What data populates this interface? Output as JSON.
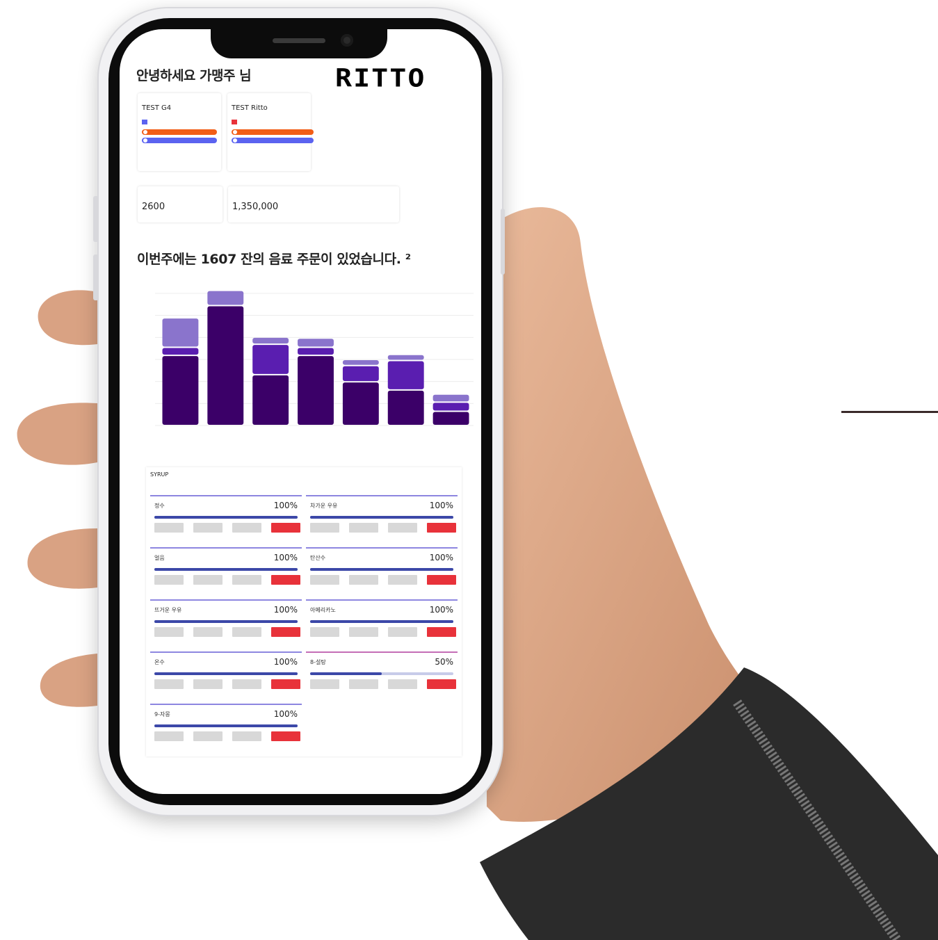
{
  "header": {
    "greeting": "안녕하세요  가맹주 님",
    "logo": "RITTO"
  },
  "machines": [
    {
      "caption": "",
      "name": "TEST G4",
      "status": "",
      "alert": "",
      "ok": "",
      "link": ""
    },
    {
      "caption": "",
      "name": "TEST Ritto",
      "status": "",
      "alert": "",
      "ok": "",
      "link": ""
    }
  ],
  "kpis": [
    {
      "caption": "",
      "value": "2600",
      "delta": ""
    },
    {
      "caption": "",
      "value": "1,350,000",
      "delta": ""
    }
  ],
  "weekly": {
    "headline": "이번주에는 1607 잔의 음료 주문이 있었습니다. ²",
    "subline": "",
    "footnotes": [
      "",
      ""
    ]
  },
  "chart_data": {
    "type": "bar",
    "stacked": true,
    "categories": [
      "",
      "",
      "",
      "",
      "",
      "",
      ""
    ],
    "series": [
      {
        "values": [
          345,
          590,
          250,
          345,
          215,
          175,
          70
        ],
        "color": "#3b0068"
      },
      {
        "values": [
          40,
          0,
          150,
          40,
          80,
          145,
          45
        ],
        "color": "#5a1eb0"
      },
      {
        "values": [
          145,
          75,
          35,
          45,
          30,
          30,
          40
        ],
        "color": "#8a74cc"
      }
    ],
    "ylim": [
      0,
      650
    ],
    "grid": true,
    "legend": "none"
  },
  "syrup": {
    "title": "SYRUP",
    "subtitle": "",
    "items": [
      {
        "name": "정수",
        "percent": "100%",
        "level": 1.0,
        "buttons": [
          "",
          "",
          "",
          ""
        ]
      },
      {
        "name": "차가운 우유",
        "percent": "100%",
        "level": 1.0,
        "buttons": [
          "",
          "",
          "",
          ""
        ]
      },
      {
        "name": "얼음",
        "percent": "100%",
        "level": 1.0,
        "buttons": [
          "",
          "",
          "",
          ""
        ]
      },
      {
        "name": "탄산수",
        "percent": "100%",
        "level": 1.0,
        "buttons": [
          "",
          "",
          "",
          ""
        ]
      },
      {
        "name": "뜨거운 우유",
        "percent": "100%",
        "level": 1.0,
        "buttons": [
          "",
          "",
          "",
          ""
        ]
      },
      {
        "name": "아메리카노",
        "percent": "100%",
        "level": 1.0,
        "buttons": [
          "",
          "",
          "",
          ""
        ]
      },
      {
        "name": "온수",
        "percent": "100%",
        "level": 1.0,
        "buttons": [
          "",
          "",
          "",
          ""
        ]
      },
      {
        "name": "8-설탕",
        "percent": "50%",
        "level": 0.5,
        "buttons": [
          "",
          "",
          "",
          ""
        ]
      },
      {
        "name": "9-자몽",
        "percent": "100%",
        "level": 1.0,
        "buttons": [
          "",
          "",
          "",
          ""
        ]
      }
    ]
  },
  "colors": {
    "accent": "#3c48a8",
    "alert_pill": "#f25d16",
    "ok_pill": "#5b63f0",
    "warn_button": "#e8323a",
    "bar_dark": "#3b0068"
  }
}
